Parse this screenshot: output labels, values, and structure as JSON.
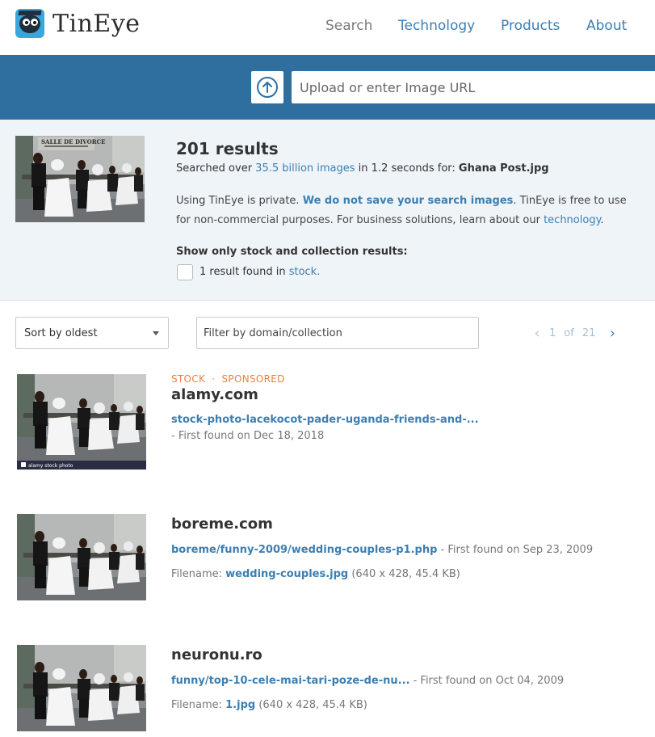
{
  "header": {
    "logo_text": "TinEye",
    "nav": {
      "search": "Search",
      "technology": "Technology",
      "products": "Products",
      "about": "About"
    }
  },
  "search": {
    "placeholder": "Upload or enter Image URL",
    "value": ""
  },
  "summary": {
    "results_count": "201 results",
    "searched_prefix": "Searched over ",
    "index_size": "35.5 billion images",
    "searched_mid": " in 1.2 seconds for: ",
    "query_file": "Ghana Post.jpg",
    "privacy_1": "Using TinEye is private. ",
    "privacy_link": "We do not save your search images",
    "privacy_2": ". TinEye is free to use for non-commercial purposes. For business solutions, learn about our ",
    "technology_link": "technology",
    "privacy_3": ".",
    "stock_title": "Show only stock and collection results:",
    "stock_count_text": "1 result found in ",
    "stock_link": "stock."
  },
  "controls": {
    "sort_label": "Sort by oldest",
    "filter_placeholder": "Filter by domain/collection",
    "pager": {
      "current": "1",
      "of": "of",
      "total": "21"
    }
  },
  "results": [
    {
      "tag_stock": "STOCK",
      "tag_sep": "·",
      "tag_sponsored": "SPONSORED",
      "domain": "alamy.com",
      "link": "stock-photo-lacekocot-pader-uganda-friends-and-...",
      "found": "- First found on Dec 18, 2018",
      "watermark": "alamy stock photo"
    },
    {
      "domain": "boreme.com",
      "link": "boreme/funny-2009/wedding-couples-p1.php",
      "found": " - First found on Sep 23, 2009",
      "file_label": "Filename: ",
      "file_name": "wedding-couples.jpg",
      "file_meta": " (640 x 428, 45.4 KB)"
    },
    {
      "domain": "neuronu.ro",
      "link": "funny/top-10-cele-mai-tari-poze-de-nu...",
      "found": " - First found on Oct 04, 2009",
      "file_label": "Filename: ",
      "file_name": "1.jpg",
      "file_meta": " (640 x 428, 45.4 KB)"
    }
  ],
  "thumb_sign": "SALLE DE DIVORCE"
}
